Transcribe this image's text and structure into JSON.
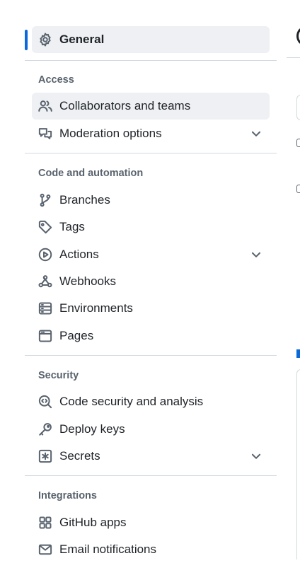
{
  "sidebar": {
    "general": {
      "label": "General",
      "icon": "gear-icon"
    },
    "sections": [
      {
        "heading": "Access",
        "items": [
          {
            "label": "Collaborators and teams",
            "icon": "people-icon",
            "selected": true
          },
          {
            "label": "Moderation options",
            "icon": "comment-discussion-icon",
            "expandable": true
          }
        ]
      },
      {
        "heading": "Code and automation",
        "items": [
          {
            "label": "Branches",
            "icon": "git-branch-icon"
          },
          {
            "label": "Tags",
            "icon": "tag-icon"
          },
          {
            "label": "Actions",
            "icon": "play-icon",
            "expandable": true
          },
          {
            "label": "Webhooks",
            "icon": "webhook-icon"
          },
          {
            "label": "Environments",
            "icon": "server-icon"
          },
          {
            "label": "Pages",
            "icon": "browser-icon"
          }
        ]
      },
      {
        "heading": "Security",
        "items": [
          {
            "label": "Code security and analysis",
            "icon": "codescan-icon"
          },
          {
            "label": "Deploy keys",
            "icon": "key-icon"
          },
          {
            "label": "Secrets",
            "icon": "key-asterisk-icon",
            "expandable": true
          }
        ]
      },
      {
        "heading": "Integrations",
        "items": [
          {
            "label": "GitHub apps",
            "icon": "apps-icon"
          },
          {
            "label": "Email notifications",
            "icon": "mail-icon"
          }
        ]
      }
    ]
  },
  "colors": {
    "accent": "#0969da",
    "selected_bg": "#eef0f3",
    "text": "#1f2328",
    "muted": "#59636e",
    "border": "#d1d9e0"
  }
}
